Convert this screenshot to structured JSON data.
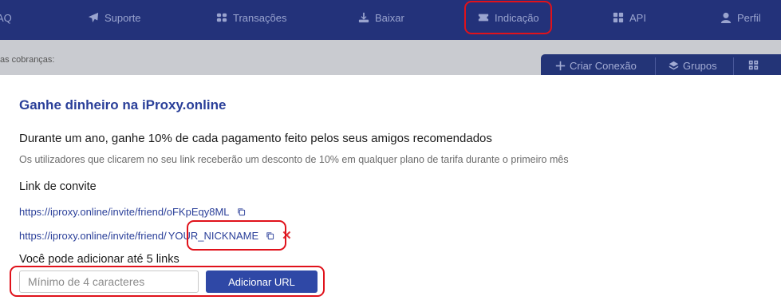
{
  "nav": {
    "items": [
      {
        "label": "AQ",
        "icon": "help-icon"
      },
      {
        "label": "Suporte",
        "icon": "send-icon"
      },
      {
        "label": "Transações",
        "icon": "transactions-icon"
      },
      {
        "label": "Baixar",
        "icon": "download-icon"
      },
      {
        "label": "Indicação",
        "icon": "ticket-icon"
      },
      {
        "label": "API",
        "icon": "grid-icon"
      },
      {
        "label": "Perfil",
        "icon": "user-icon"
      }
    ],
    "highlighted": "Indicação"
  },
  "backdrop": {
    "text": "as cobranças:",
    "toolbar": {
      "create_label": "Criar Conexão",
      "groups_label": "Grupos"
    }
  },
  "modal": {
    "title": "Ganhe dinheiro na iProxy.online",
    "subtitle": "Durante um ano, ganhe 10% de cada pagamento feito pelos seus amigos recomendados",
    "description": "Os utilizadores que clicarem no seu link receberão um desconto de 10% em qualquer plano de tarifa durante o primeiro mês",
    "invite_heading": "Link de convite",
    "links": [
      {
        "base": "https://iproxy.online/invite/friend/oFKpEqy8ML",
        "nickname": ""
      },
      {
        "base": "https://iproxy.online/invite/friend/",
        "nickname": "YOUR_NICKNAME"
      }
    ],
    "limit_text": "Você pode adicionar até 5 links",
    "input_placeholder": "Mínimo de 4 caracteres",
    "add_button": "Adicionar URL"
  },
  "colors": {
    "nav_bg": "#23327a",
    "accent": "#2f48a6",
    "link": "#2a3f99",
    "highlight": "#e0121b",
    "remove": "#e0333a"
  }
}
